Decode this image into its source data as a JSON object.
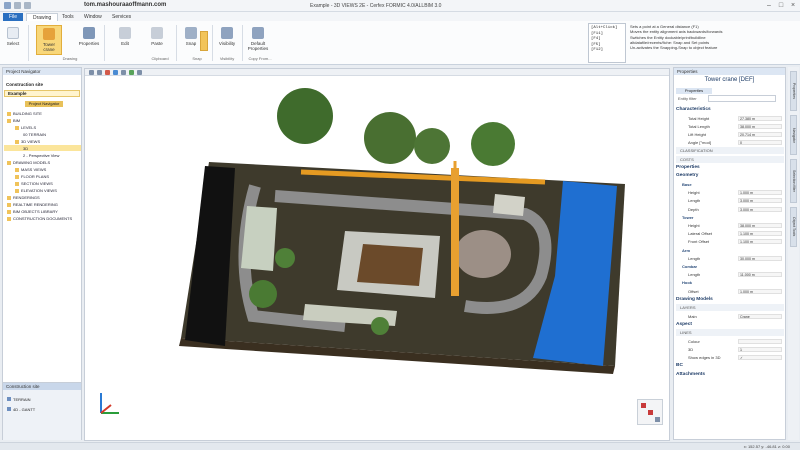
{
  "window": {
    "url": "tom.mashouraaoffmann.com",
    "title": "Example - 3D VIEWS 2E - Cerfex FORMIC 4.0/ALLBIM 3.0"
  },
  "tabs": [
    "File",
    "Drawing",
    "Tools",
    "Window",
    "Services"
  ],
  "ribbon": {
    "buttons": [
      {
        "label": "Select",
        "icon": "cursor-icon"
      },
      {
        "label": "Tower crane",
        "icon": "tower-crane-icon"
      },
      {
        "label": "Properties",
        "icon": "properties-icon"
      },
      {
        "label": "Edit",
        "icon": "edit-icon"
      },
      {
        "label": "Paste",
        "icon": "paste-icon"
      },
      {
        "label": "Snap",
        "icon": "snap-icon"
      },
      {
        "label": "Visibility",
        "icon": "visibility-icon"
      },
      {
        "label": "Default Properties",
        "icon": "default-properties-icon"
      }
    ],
    "groups": [
      "Drawing",
      "Clipboard",
      "Snap",
      "Visibility",
      "Copy From..."
    ]
  },
  "help": {
    "keys": [
      "[Alt+Click]",
      "[F11]",
      "[F4]",
      "[F5]",
      "[F12]"
    ],
    "text": [
      "Sets a point at a General distance (F1)",
      "Moves the entity alignment axis backwards/forwards",
      "Switches the Entity dockable/print/buildline",
      "altdatafile/recents/fiche: Snap and Set points",
      "Un-activates the Snapping-Snap to object feature"
    ]
  },
  "left": {
    "header": "Project Navigator",
    "section": "Construction site",
    "project": "Example",
    "tab": "Project Navigator",
    "tree": [
      "BUILDING SITE",
      "BIM",
      "LEVELS",
      "00 TERRAIN",
      "3D VIEWS",
      "3D",
      "2 - Perspective View",
      "DRAWING MODELS",
      "MASS VIEWS",
      "FLOOR PLANS",
      "SECTION VIEWS",
      "ELEVATION VIEWS",
      "RENDERINGS",
      "REALTIME RENDERING",
      "BIM OBJECTS LIBRARY",
      "CONSTRUCTION DOCUMENTS"
    ],
    "bottom": {
      "header": "Construction site",
      "items": [
        "TERRAIN",
        "4D - GANTT"
      ]
    }
  },
  "viewport": {
    "axes": [
      "X",
      "Y",
      "Z"
    ]
  },
  "right": {
    "header": "Properties",
    "object": "Tower crane [DEF]",
    "tab": "Properties",
    "filter_label": "Entity filter",
    "sections": [
      {
        "kind": "h1",
        "label": "Characteristics"
      },
      {
        "kind": "f",
        "label": "Total Height",
        "value": "27.380 m"
      },
      {
        "kind": "f",
        "label": "Total Length",
        "value": "38.000 m"
      },
      {
        "kind": "f",
        "label": "Lift Height",
        "value": "20.714 m"
      },
      {
        "kind": "f",
        "label": "Angle [°mod]",
        "value": "0"
      },
      {
        "kind": "sub",
        "label": "CLASSIFICATION"
      },
      {
        "kind": "sub",
        "label": "COSTS"
      },
      {
        "kind": "h1",
        "label": "Properties"
      },
      {
        "kind": "h1",
        "label": "Geometry"
      },
      {
        "kind": "h2",
        "label": "Base"
      },
      {
        "kind": "f",
        "label": "Height",
        "value": "1.000 m"
      },
      {
        "kind": "f",
        "label": "Length",
        "value": "3.000 m"
      },
      {
        "kind": "f",
        "label": "Depth",
        "value": "3.000 m"
      },
      {
        "kind": "h2",
        "label": "Tower"
      },
      {
        "kind": "f",
        "label": "Height",
        "value": "38.000 m"
      },
      {
        "kind": "f",
        "label": "Lateral Offset",
        "value": "1.100 m"
      },
      {
        "kind": "f",
        "label": "Front Offset",
        "value": "1.100 m"
      },
      {
        "kind": "h2",
        "label": "Arm"
      },
      {
        "kind": "f",
        "label": "Length",
        "value": "30.000 m"
      },
      {
        "kind": "h2",
        "label": "Combar"
      },
      {
        "kind": "f",
        "label": "Length",
        "value": "11.000 m"
      },
      {
        "kind": "h2",
        "label": "Hook"
      },
      {
        "kind": "f",
        "label": "Offset",
        "value": "1.000 m"
      },
      {
        "kind": "h1",
        "label": "Drawing Models"
      },
      {
        "kind": "sub",
        "label": "LAYERS"
      },
      {
        "kind": "f",
        "label": "Main",
        "value": "Crane"
      },
      {
        "kind": "h1",
        "label": "Aspect"
      },
      {
        "kind": "sub",
        "label": "LINES"
      },
      {
        "kind": "f",
        "label": "Colour",
        "value": ""
      },
      {
        "kind": "f",
        "label": "3D",
        "value": "1"
      },
      {
        "kind": "f",
        "label": "Show edges in 3D",
        "value": "✓"
      },
      {
        "kind": "h1",
        "label": "BC"
      },
      {
        "kind": "h1",
        "label": "Attachments"
      }
    ]
  },
  "right_strip": [
    "Properties",
    "Navigator",
    "Selection filter",
    "Object Tools"
  ],
  "status": "x: 152.57  y: -46.81  z: 0.00"
}
